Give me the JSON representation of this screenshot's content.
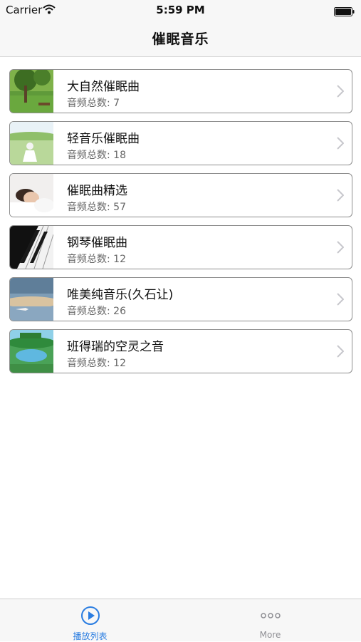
{
  "status_bar": {
    "carrier": "Carrier",
    "time": "5:59 PM"
  },
  "nav": {
    "title": "催眠音乐"
  },
  "list": {
    "items": [
      {
        "title": "大自然催眠曲",
        "subtitle": "音频总数: 7",
        "thumbnail": "forest-scene"
      },
      {
        "title": "轻音乐催眠曲",
        "subtitle": "音频总数: 18",
        "thumbnail": "meadow-girl-scene"
      },
      {
        "title": "催眠曲精选",
        "subtitle": "音频总数: 57",
        "thumbnail": "sleeping-woman-scene"
      },
      {
        "title": "钢琴催眠曲",
        "subtitle": "音频总数: 12",
        "thumbnail": "piano-keys-scene"
      },
      {
        "title": "唯美纯音乐(久石让)",
        "subtitle": "音频总数: 26",
        "thumbnail": "sky-airplane-scene"
      },
      {
        "title": "班得瑞的空灵之音",
        "subtitle": "音频总数: 12",
        "thumbnail": "lake-album-scene"
      }
    ]
  },
  "tab_bar": {
    "tabs": [
      {
        "label": "播放列表",
        "icon": "play-circle-icon",
        "active": true
      },
      {
        "label": "More",
        "icon": "more-dots-icon",
        "active": false
      }
    ],
    "accent_color": "#2a7de1",
    "inactive_color": "#8e8e93"
  }
}
